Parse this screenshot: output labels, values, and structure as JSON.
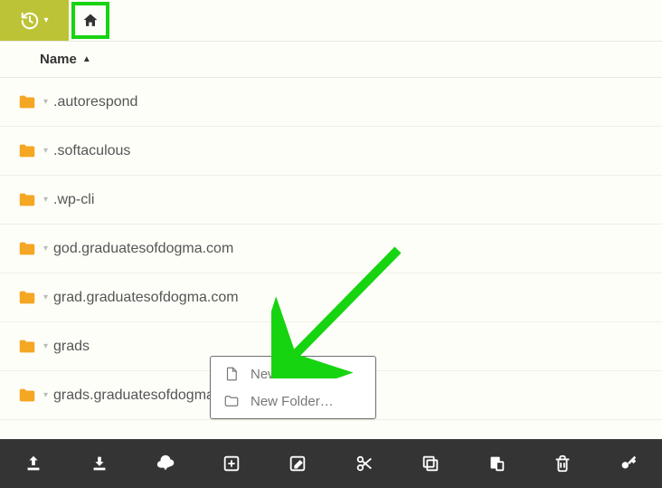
{
  "header": {
    "column_label": "Name",
    "sort_caret": "▲"
  },
  "folders": [
    {
      "name": ".autorespond"
    },
    {
      "name": ".softaculous"
    },
    {
      "name": ".wp-cli"
    },
    {
      "name": "god.graduatesofdogma.com"
    },
    {
      "name": "grad.graduatesofdogma.com"
    },
    {
      "name": "grads"
    },
    {
      "name": "grads.graduatesofdogma.com"
    }
  ],
  "context_menu": {
    "new_file": "New File…",
    "new_folder": "New Folder…"
  },
  "toolbar": {
    "upload": "upload",
    "download": "download",
    "cloud": "cloud-download",
    "new": "new",
    "edit": "edit",
    "cut": "cut",
    "copy": "copy",
    "paste": "paste",
    "delete": "delete",
    "permissions": "permissions"
  }
}
